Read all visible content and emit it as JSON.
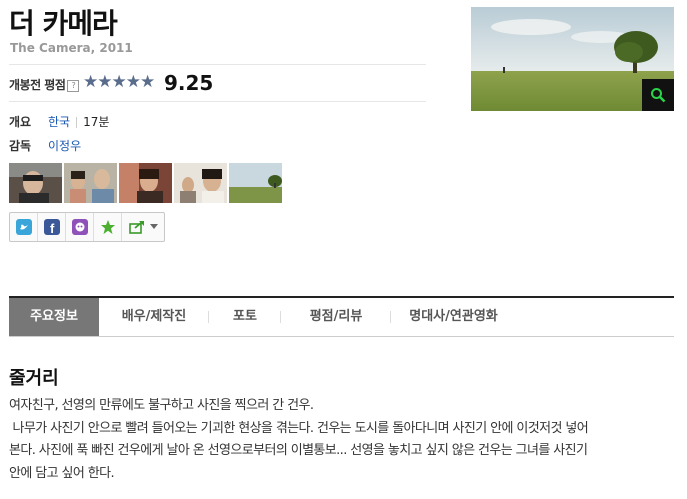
{
  "movie": {
    "title": "더 카메라",
    "subtitle": "The Camera, 2011"
  },
  "rating": {
    "label": "개봉전 평점",
    "help": "?",
    "stars": "★★★★★",
    "score": "9.25",
    "stars_fraction": 0.925
  },
  "overview": {
    "label": "개요",
    "country": "한국",
    "runtime": "17분"
  },
  "director": {
    "label": "감독",
    "name": "이정우"
  },
  "share_icons": [
    "twitter-icon",
    "facebook-icon",
    "me2day-icon",
    "favorite-star-icon",
    "share-icon"
  ],
  "tabs": [
    "주요정보",
    "배우/제작진",
    "포토",
    "평점/리뷰",
    "명대사/연관영화"
  ],
  "synopsis": {
    "heading": "줄거리",
    "line1": "여자친구, 선영의 만류에도 불구하고 사진을 찍으러 간 건우.",
    "line2": " 나무가 사진기 안으로 빨려 들어오는 기괴한 현상을 겪는다. 건우는 도시를 돌아다니며 사진기 안에 이것저것 넣어",
    "line3": "본다. 사진에 푹 빠진 건우에게 날아 온 선영으로부터의 이별통보... 선영을 놓치고 싶지 않은 건우는 그녀를 사진기",
    "line4": "안에 담고 싶어 한다."
  },
  "colors": {
    "link": "#1a58b3",
    "active_tab": "#777777",
    "stars": "#5a6c8c"
  }
}
